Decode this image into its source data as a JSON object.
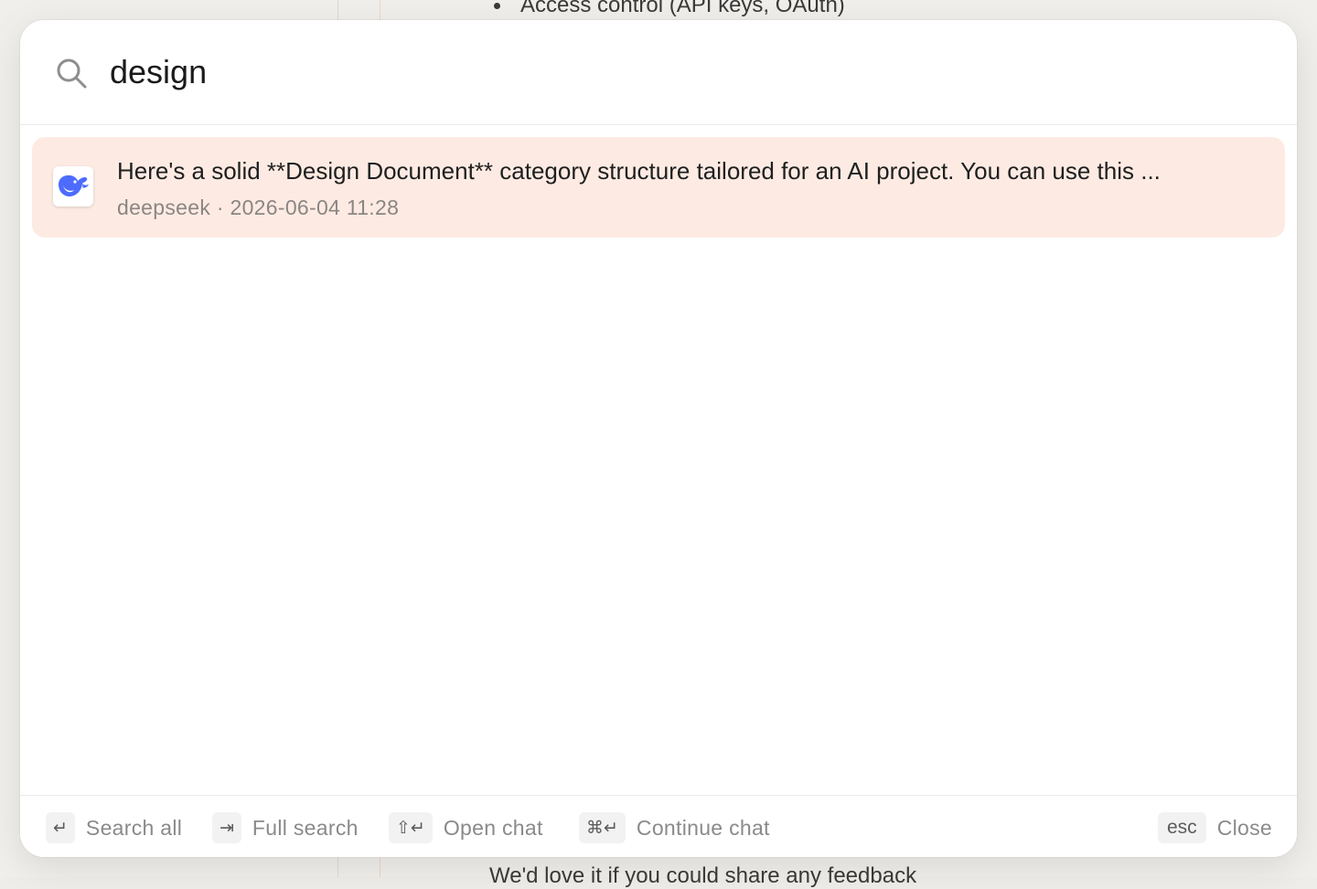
{
  "background": {
    "top_text": "Access control (API keys, OAuth)",
    "bottom_text": "We'd love it if you could share any feedback"
  },
  "search": {
    "value": "design",
    "icon": "search-icon"
  },
  "results": [
    {
      "title": "Here's a solid **Design Document** category structure tailored for an AI project. You can use this ...",
      "source": "deepseek",
      "timestamp": "2026-06-04 11:28",
      "meta": "deepseek · 2026-06-04 11:28",
      "icon": "deepseek-whale-icon",
      "icon_color": "#4d6bfe",
      "highlight_color": "#fdebe3"
    }
  ],
  "footer": {
    "hints": [
      {
        "key": "↵",
        "label": "Search all"
      },
      {
        "key": "⇥",
        "label": "Full search"
      },
      {
        "key": "⇧↵",
        "label": "Open chat"
      },
      {
        "key": "⌘↵",
        "label": "Continue chat"
      }
    ],
    "close": {
      "key": "esc",
      "label": "Close"
    }
  }
}
